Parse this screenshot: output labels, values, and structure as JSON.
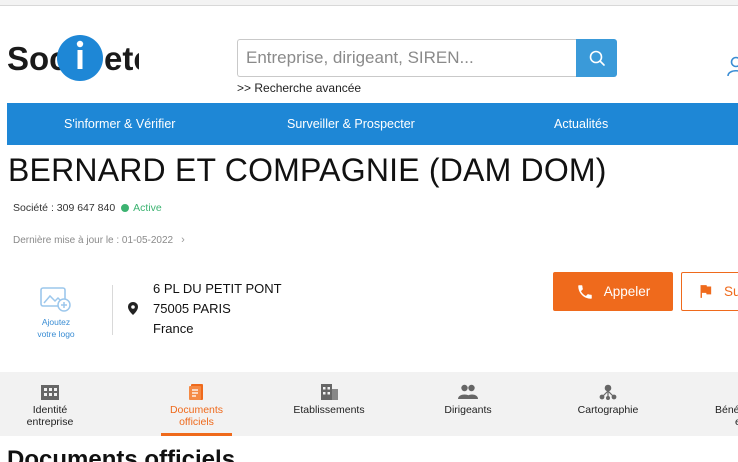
{
  "brand": {
    "logo_text": "Societe",
    "accent": "#1e87d6",
    "orange": "#ef6a1c"
  },
  "search": {
    "placeholder": "Entreprise, dirigeant, SIREN...",
    "advanced_label": ">> Recherche avancée"
  },
  "nav": {
    "items": [
      "S'informer & Vérifier",
      "Surveiller & Prospecter",
      "Actualités"
    ]
  },
  "company": {
    "name": "BERNARD ET COMPAGNIE (DAM DOM)",
    "siren_line": "Société : 309 647 840",
    "status": "Active",
    "last_update": "Dernière mise à jour le : 01-05-2022",
    "logo_add_line1": "Ajoutez",
    "logo_add_line2": "votre logo",
    "address": [
      "6 PL DU PETIT PONT",
      "75005 PARIS",
      "France"
    ]
  },
  "actions": {
    "call": "Appeler",
    "follow": "Suivre"
  },
  "tabs": [
    {
      "line1": "Identité",
      "line2": "entreprise",
      "icon": "building-icon"
    },
    {
      "line1": "Documents",
      "line2": "officiels",
      "icon": "documents-icon",
      "active": true
    },
    {
      "line1": "Etablissements",
      "line2": "",
      "icon": "office-icon"
    },
    {
      "line1": "Dirigeants",
      "line2": "",
      "icon": "people-icon"
    },
    {
      "line1": "Cartographie",
      "line2": "",
      "icon": "network-icon"
    },
    {
      "line1": "Béné",
      "line2": "eff",
      "icon": "beneficiaries-icon"
    }
  ],
  "section": {
    "title": "Documents officiels"
  }
}
